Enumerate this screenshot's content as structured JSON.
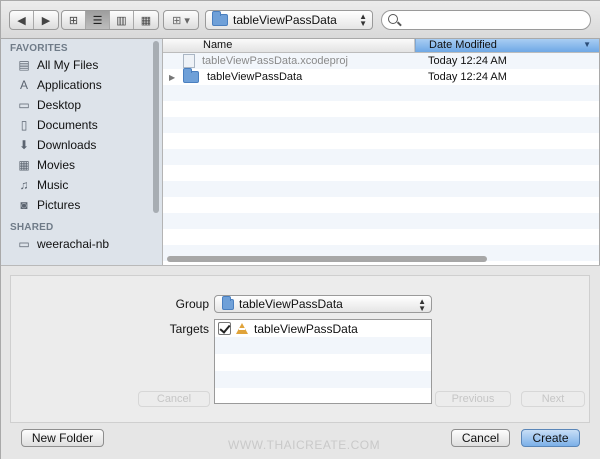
{
  "toolbar": {
    "back_icon": "chevron-left-icon",
    "forward_icon": "chevron-right-icon",
    "view_modes": [
      "icon-view",
      "list-view",
      "column-view",
      "coverflow-view"
    ],
    "arrange_icon": "grid-menu-icon",
    "location": "tableViewPassData",
    "search_placeholder": ""
  },
  "sidebar": {
    "favorites_header": "FAVORITES",
    "favorites": [
      {
        "label": "All My Files",
        "icon": "files-icon"
      },
      {
        "label": "Applications",
        "icon": "applications-icon"
      },
      {
        "label": "Desktop",
        "icon": "desktop-icon"
      },
      {
        "label": "Documents",
        "icon": "documents-icon"
      },
      {
        "label": "Downloads",
        "icon": "downloads-icon"
      },
      {
        "label": "Movies",
        "icon": "movies-icon"
      },
      {
        "label": "Music",
        "icon": "music-icon"
      },
      {
        "label": "Pictures",
        "icon": "camera-icon"
      }
    ],
    "shared_header": "SHARED",
    "shared": [
      {
        "label": "weerachai-nb",
        "icon": "computer-icon"
      }
    ]
  },
  "filelist": {
    "columns": {
      "name": "Name",
      "date": "Date Modified"
    },
    "rows": [
      {
        "name": "tableViewPassData.xcodeproj",
        "date": "Today 12:24 AM",
        "kind": "file"
      },
      {
        "name": "tableViewPassData",
        "date": "Today 12:24 AM",
        "kind": "folder"
      }
    ]
  },
  "panel": {
    "group_label": "Group",
    "group_value": "tableViewPassData",
    "targets_label": "Targets",
    "targets": [
      {
        "name": "tableViewPassData",
        "checked": true
      }
    ],
    "background_buttons": {
      "cancel": "Cancel",
      "previous": "Previous",
      "next": "Next"
    },
    "new_folder": "New Folder",
    "cancel": "Cancel",
    "create": "Create",
    "watermark": "WWW.THAICREATE.COM"
  },
  "colors": {
    "sidebar_bg": "#dde3ea",
    "selected_column": "#6fa8e5",
    "primary_button": "#7cb0e8"
  }
}
